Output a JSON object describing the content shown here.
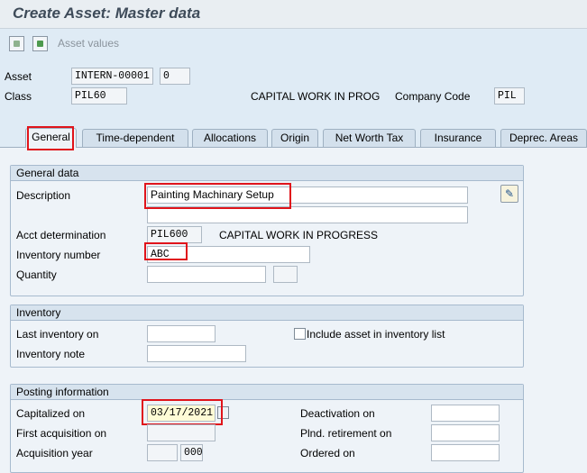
{
  "window": {
    "title": "Create Asset:  Master data"
  },
  "toolbar": {
    "prev_icon": "previous-object-icon",
    "next_icon": "next-object-icon",
    "asset_values_label": "Asset values"
  },
  "header": {
    "asset_label": "Asset",
    "asset_value": "INTERN-00001",
    "asset_subnumber": "0",
    "class_label": "Class",
    "class_value": "PIL60",
    "class_desc": "CAPITAL WORK IN PROG",
    "company_code_label": "Company Code",
    "company_code_value": "PIL"
  },
  "tabs": [
    {
      "label": "General",
      "active": true
    },
    {
      "label": "Time-dependent"
    },
    {
      "label": "Allocations"
    },
    {
      "label": "Origin"
    },
    {
      "label": "Net Worth Tax"
    },
    {
      "label": "Insurance"
    },
    {
      "label": "Deprec. Areas"
    }
  ],
  "general_data": {
    "title": "General data",
    "description_label": "Description",
    "description_line1": "Painting Machinary Setup",
    "description_line2": "",
    "acct_determination_label": "Acct determination",
    "acct_determination_value": "PIL600",
    "acct_determination_desc": "CAPITAL WORK IN PROGRESS",
    "inventory_number_label": "Inventory number",
    "inventory_number_value": "ABC",
    "quantity_label": "Quantity",
    "quantity_value": "",
    "unit_value": ""
  },
  "inventory": {
    "title": "Inventory",
    "last_inventory_label": "Last inventory on",
    "last_inventory_value": "",
    "include_label": "Include asset in inventory list",
    "include_checked": false,
    "inventory_note_label": "Inventory note",
    "inventory_note_value": ""
  },
  "posting": {
    "title": "Posting information",
    "capitalized_label": "Capitalized on",
    "capitalized_value": "03/17/2021",
    "first_acq_label": "First acquisition on",
    "first_acq_value": "",
    "acq_year_label": "Acquisition year",
    "acq_year_value": "",
    "acq_period_value": "000",
    "deactivation_label": "Deactivation on",
    "deactivation_value": "",
    "planned_retirement_label": "Plnd. retirement on",
    "planned_retirement_value": "",
    "ordered_label": "Ordered on",
    "ordered_value": ""
  },
  "colors": {
    "highlight": "#e0141b",
    "focus_field": "#fffbd6",
    "background": "#dfebf5"
  }
}
